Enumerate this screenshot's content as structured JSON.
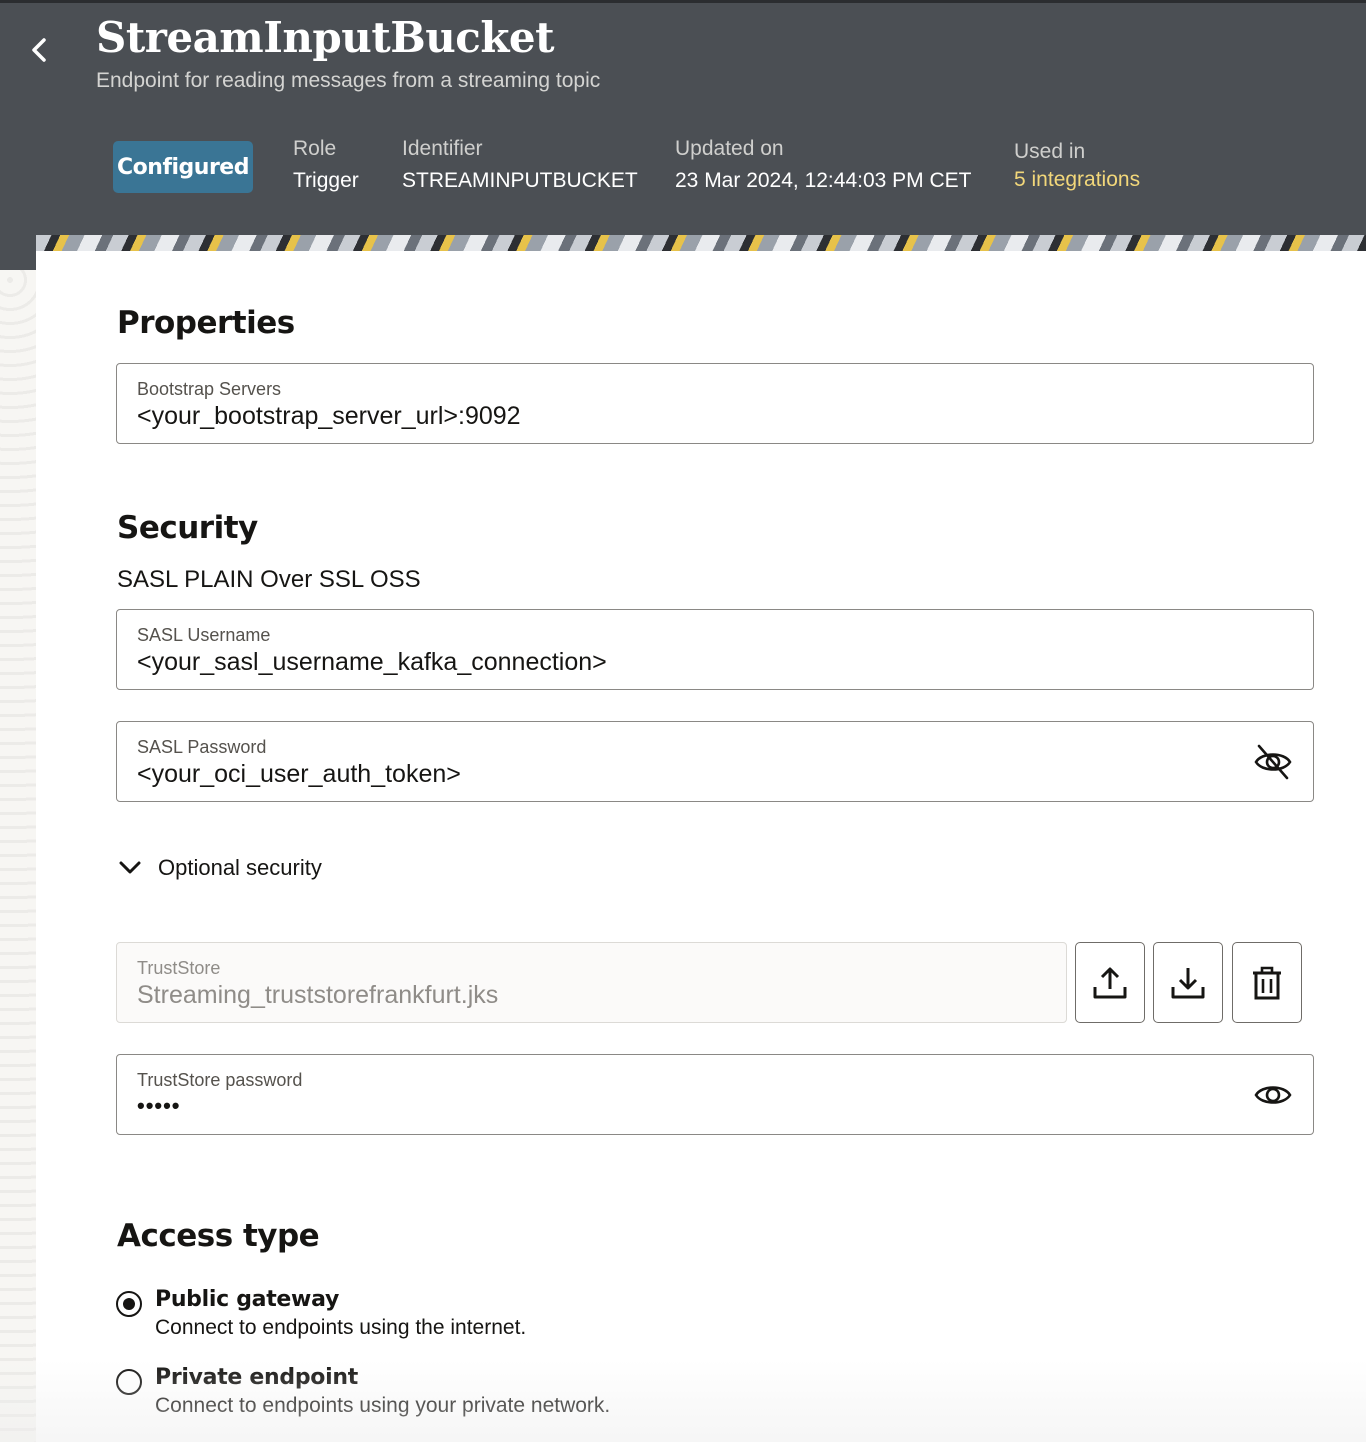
{
  "header": {
    "title": "StreamInputBucket",
    "subtitle": "Endpoint for reading messages from a streaming topic",
    "status_badge": "Configured",
    "role_label": "Role",
    "role_value": "Trigger",
    "identifier_label": "Identifier",
    "identifier_value": "STREAMINPUTBUCKET",
    "updated_label": "Updated on",
    "updated_value": "23 Mar 2024, 12:44:03 PM CET",
    "used_in_label": "Used in",
    "used_in_link": "5 integrations"
  },
  "properties": {
    "heading": "Properties",
    "bootstrap_label": "Bootstrap Servers",
    "bootstrap_value": "<your_bootstrap_server_url>:9092"
  },
  "security": {
    "heading": "Security",
    "policy": "SASL PLAIN Over SSL OSS",
    "username_label": "SASL Username",
    "username_value": "<your_sasl_username_kafka_connection>",
    "password_label": "SASL Password",
    "password_value": "<your_oci_user_auth_token>",
    "optional_label": "Optional security",
    "truststore_label": "TrustStore",
    "truststore_value": "Streaming_truststorefrankfurt.jks",
    "truststore_password_label": "TrustStore password",
    "truststore_password_value": "•••••"
  },
  "access": {
    "heading": "Access type",
    "options": [
      {
        "title": "Public gateway",
        "desc": "Connect to endpoints using the internet.",
        "selected": true
      },
      {
        "title": "Private endpoint",
        "desc": "Connect to endpoints using your private network.",
        "selected": false
      }
    ]
  },
  "icons": {
    "back": "chevron-left-icon",
    "eye_hidden": "eye-slash-icon",
    "eye": "eye-icon",
    "upload": "upload-icon",
    "download": "download-icon",
    "delete": "trash-icon",
    "chevron": "chevron-down-icon"
  },
  "colors": {
    "header_bg": "#4b4f54",
    "badge_bg": "#3a7595",
    "link": "#f2d77a"
  }
}
